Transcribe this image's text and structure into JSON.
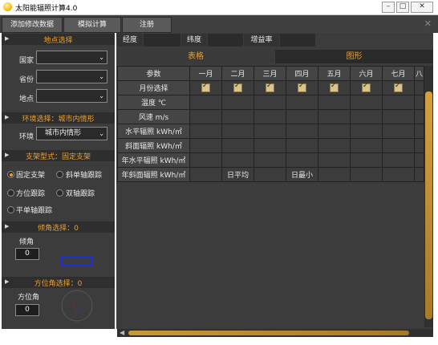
{
  "window": {
    "title": "太阳能辐照计算4.0"
  },
  "menu": {
    "items": [
      "添加修改数据",
      "模拟计算",
      "注册"
    ]
  },
  "left": {
    "location": {
      "header": "地点选择",
      "country_label": "国家",
      "province_label": "省份",
      "place_label": "地点",
      "country_value": "",
      "province_value": "",
      "place_value": ""
    },
    "environment": {
      "header": "环境选择：城市内情形",
      "label": "环境",
      "value": "城市内情形"
    },
    "mount": {
      "header": "支架型式：固定支架",
      "options": [
        "固定支架",
        "斜单轴跟踪",
        "方位跟踪",
        "双轴跟踪",
        "平单轴跟踪"
      ],
      "selected": "固定支架"
    },
    "tilt": {
      "header": "倾角选择：0",
      "label": "倾角",
      "value": "0"
    },
    "azimuth": {
      "header": "方位角选择：0",
      "label": "方位角",
      "value": "0"
    }
  },
  "coords": {
    "longitude_label": "经度",
    "latitude_label": "纬度",
    "gain_label": "增益率"
  },
  "tabs": [
    "表格",
    "图形"
  ],
  "table": {
    "columns": [
      "参数",
      "一月",
      "二月",
      "三月",
      "四月",
      "五月",
      "六月",
      "七月",
      "八"
    ],
    "rows": [
      {
        "label": "月份选择",
        "checks": [
          true,
          true,
          true,
          true,
          true,
          true,
          true
        ]
      },
      {
        "label": "温度 ℃",
        "cells": []
      },
      {
        "label": "风速 m/s",
        "cells": []
      },
      {
        "label": "水平辐照 kWh/㎡",
        "cells": []
      },
      {
        "label": "斜面辐照 kWh/㎡",
        "cells": []
      },
      {
        "label": "年水平辐照 kWh/㎡",
        "cells": []
      },
      {
        "label": "年斜面辐照 kWh/㎡",
        "cells": [
          "",
          "日平均",
          "",
          "日最小",
          "",
          "",
          ""
        ]
      }
    ]
  },
  "colors": {
    "accent": "#e8a033",
    "panel": "#3c3c3c",
    "header": "#2e2e2e"
  }
}
